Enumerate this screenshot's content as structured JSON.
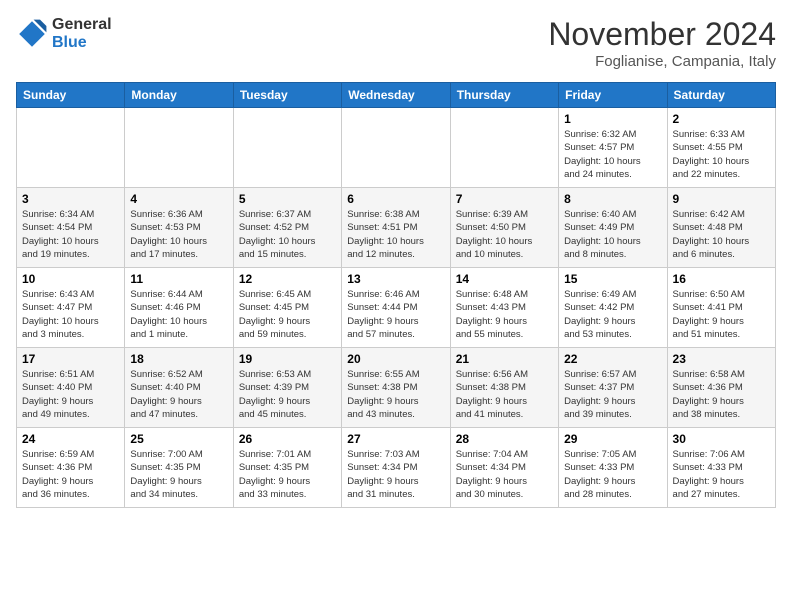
{
  "logo": {
    "line1": "General",
    "line2": "Blue"
  },
  "title": "November 2024",
  "subtitle": "Foglianise, Campania, Italy",
  "weekdays": [
    "Sunday",
    "Monday",
    "Tuesday",
    "Wednesday",
    "Thursday",
    "Friday",
    "Saturday"
  ],
  "weeks": [
    [
      {
        "day": "",
        "info": ""
      },
      {
        "day": "",
        "info": ""
      },
      {
        "day": "",
        "info": ""
      },
      {
        "day": "",
        "info": ""
      },
      {
        "day": "",
        "info": ""
      },
      {
        "day": "1",
        "info": "Sunrise: 6:32 AM\nSunset: 4:57 PM\nDaylight: 10 hours\nand 24 minutes."
      },
      {
        "day": "2",
        "info": "Sunrise: 6:33 AM\nSunset: 4:55 PM\nDaylight: 10 hours\nand 22 minutes."
      }
    ],
    [
      {
        "day": "3",
        "info": "Sunrise: 6:34 AM\nSunset: 4:54 PM\nDaylight: 10 hours\nand 19 minutes."
      },
      {
        "day": "4",
        "info": "Sunrise: 6:36 AM\nSunset: 4:53 PM\nDaylight: 10 hours\nand 17 minutes."
      },
      {
        "day": "5",
        "info": "Sunrise: 6:37 AM\nSunset: 4:52 PM\nDaylight: 10 hours\nand 15 minutes."
      },
      {
        "day": "6",
        "info": "Sunrise: 6:38 AM\nSunset: 4:51 PM\nDaylight: 10 hours\nand 12 minutes."
      },
      {
        "day": "7",
        "info": "Sunrise: 6:39 AM\nSunset: 4:50 PM\nDaylight: 10 hours\nand 10 minutes."
      },
      {
        "day": "8",
        "info": "Sunrise: 6:40 AM\nSunset: 4:49 PM\nDaylight: 10 hours\nand 8 minutes."
      },
      {
        "day": "9",
        "info": "Sunrise: 6:42 AM\nSunset: 4:48 PM\nDaylight: 10 hours\nand 6 minutes."
      }
    ],
    [
      {
        "day": "10",
        "info": "Sunrise: 6:43 AM\nSunset: 4:47 PM\nDaylight: 10 hours\nand 3 minutes."
      },
      {
        "day": "11",
        "info": "Sunrise: 6:44 AM\nSunset: 4:46 PM\nDaylight: 10 hours\nand 1 minute."
      },
      {
        "day": "12",
        "info": "Sunrise: 6:45 AM\nSunset: 4:45 PM\nDaylight: 9 hours\nand 59 minutes."
      },
      {
        "day": "13",
        "info": "Sunrise: 6:46 AM\nSunset: 4:44 PM\nDaylight: 9 hours\nand 57 minutes."
      },
      {
        "day": "14",
        "info": "Sunrise: 6:48 AM\nSunset: 4:43 PM\nDaylight: 9 hours\nand 55 minutes."
      },
      {
        "day": "15",
        "info": "Sunrise: 6:49 AM\nSunset: 4:42 PM\nDaylight: 9 hours\nand 53 minutes."
      },
      {
        "day": "16",
        "info": "Sunrise: 6:50 AM\nSunset: 4:41 PM\nDaylight: 9 hours\nand 51 minutes."
      }
    ],
    [
      {
        "day": "17",
        "info": "Sunrise: 6:51 AM\nSunset: 4:40 PM\nDaylight: 9 hours\nand 49 minutes."
      },
      {
        "day": "18",
        "info": "Sunrise: 6:52 AM\nSunset: 4:40 PM\nDaylight: 9 hours\nand 47 minutes."
      },
      {
        "day": "19",
        "info": "Sunrise: 6:53 AM\nSunset: 4:39 PM\nDaylight: 9 hours\nand 45 minutes."
      },
      {
        "day": "20",
        "info": "Sunrise: 6:55 AM\nSunset: 4:38 PM\nDaylight: 9 hours\nand 43 minutes."
      },
      {
        "day": "21",
        "info": "Sunrise: 6:56 AM\nSunset: 4:38 PM\nDaylight: 9 hours\nand 41 minutes."
      },
      {
        "day": "22",
        "info": "Sunrise: 6:57 AM\nSunset: 4:37 PM\nDaylight: 9 hours\nand 39 minutes."
      },
      {
        "day": "23",
        "info": "Sunrise: 6:58 AM\nSunset: 4:36 PM\nDaylight: 9 hours\nand 38 minutes."
      }
    ],
    [
      {
        "day": "24",
        "info": "Sunrise: 6:59 AM\nSunset: 4:36 PM\nDaylight: 9 hours\nand 36 minutes."
      },
      {
        "day": "25",
        "info": "Sunrise: 7:00 AM\nSunset: 4:35 PM\nDaylight: 9 hours\nand 34 minutes."
      },
      {
        "day": "26",
        "info": "Sunrise: 7:01 AM\nSunset: 4:35 PM\nDaylight: 9 hours\nand 33 minutes."
      },
      {
        "day": "27",
        "info": "Sunrise: 7:03 AM\nSunset: 4:34 PM\nDaylight: 9 hours\nand 31 minutes."
      },
      {
        "day": "28",
        "info": "Sunrise: 7:04 AM\nSunset: 4:34 PM\nDaylight: 9 hours\nand 30 minutes."
      },
      {
        "day": "29",
        "info": "Sunrise: 7:05 AM\nSunset: 4:33 PM\nDaylight: 9 hours\nand 28 minutes."
      },
      {
        "day": "30",
        "info": "Sunrise: 7:06 AM\nSunset: 4:33 PM\nDaylight: 9 hours\nand 27 minutes."
      }
    ]
  ]
}
